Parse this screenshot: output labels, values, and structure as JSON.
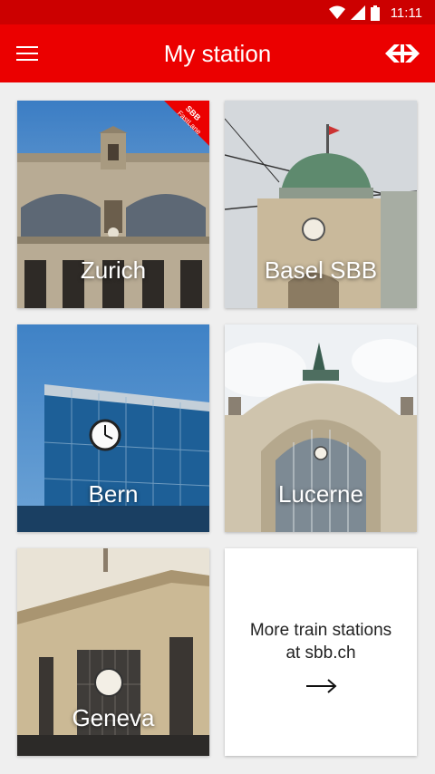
{
  "status_bar": {
    "time": "11:11"
  },
  "app_bar": {
    "title": "My station"
  },
  "tiles": [
    {
      "label": "Zurich",
      "badge_line1": "SBB",
      "badge_line2": "FastLane"
    },
    {
      "label": "Basel SBB"
    },
    {
      "label": "Bern"
    },
    {
      "label": "Lucerne"
    },
    {
      "label": "Geneva"
    }
  ],
  "more_tile": {
    "line1": "More train stations",
    "line2": "at sbb.ch"
  },
  "colors": {
    "brand_red": "#eb0000",
    "status_red": "#cc0000",
    "background": "#efefef"
  },
  "icons": [
    "wifi-icon",
    "signal-icon",
    "battery-icon",
    "menu-icon",
    "sbb-logo-icon",
    "arrow-right-icon"
  ]
}
